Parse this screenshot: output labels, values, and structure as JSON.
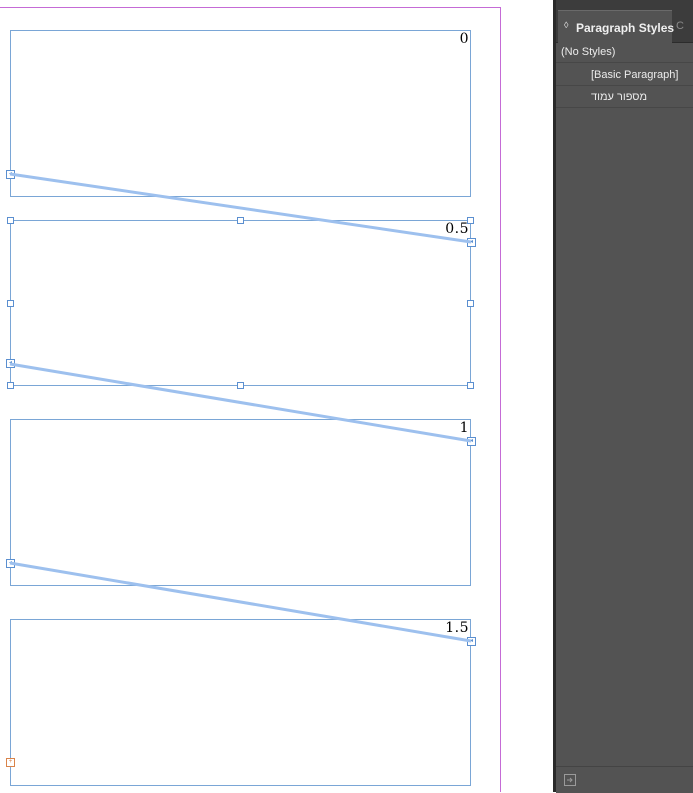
{
  "canvas": {
    "frames": [
      {
        "label": "0"
      },
      {
        "label": "0.5"
      },
      {
        "label": "1"
      },
      {
        "label": "1.5"
      }
    ]
  },
  "panel": {
    "active_tab": "Paragraph Styles",
    "next_tab_partial": "C",
    "styles": [
      "(No Styles)",
      "[Basic Paragraph]",
      "מספור עמוד"
    ]
  },
  "colors": {
    "margin_guide": "#c56bd6",
    "frame_edge": "#7aa6d6",
    "text_thread": "#9dc0ee",
    "panel_bg": "#535353",
    "tabbar_bg": "#3c3c3c"
  },
  "icons": {
    "tab_arrows": "updown-arrows-icon",
    "load_styles": "load-styles-icon"
  }
}
